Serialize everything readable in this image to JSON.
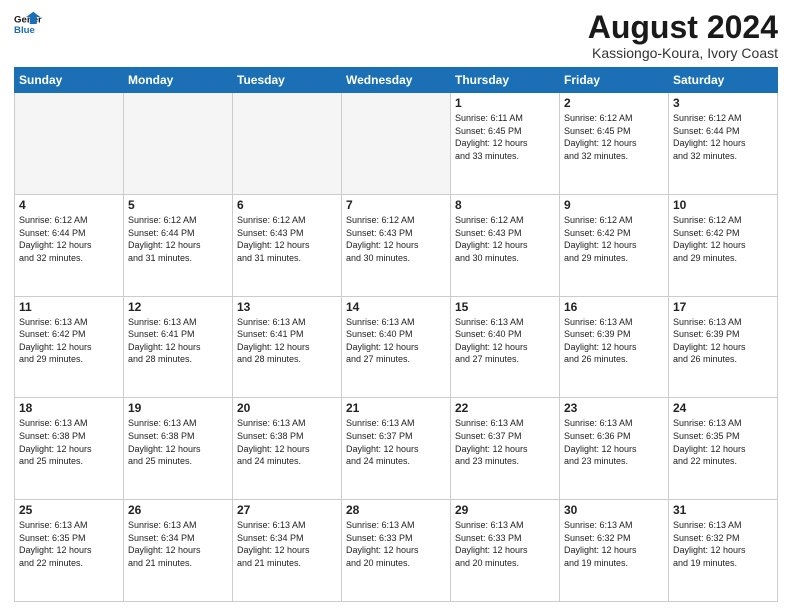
{
  "header": {
    "logo_line1": "General",
    "logo_line2": "Blue",
    "main_title": "August 2024",
    "subtitle": "Kassiongo-Koura, Ivory Coast"
  },
  "calendar": {
    "days_of_week": [
      "Sunday",
      "Monday",
      "Tuesday",
      "Wednesday",
      "Thursday",
      "Friday",
      "Saturday"
    ],
    "weeks": [
      [
        {
          "num": "",
          "info": "",
          "empty": true
        },
        {
          "num": "",
          "info": "",
          "empty": true
        },
        {
          "num": "",
          "info": "",
          "empty": true
        },
        {
          "num": "",
          "info": "",
          "empty": true
        },
        {
          "num": "1",
          "info": "Sunrise: 6:11 AM\nSunset: 6:45 PM\nDaylight: 12 hours\nand 33 minutes."
        },
        {
          "num": "2",
          "info": "Sunrise: 6:12 AM\nSunset: 6:45 PM\nDaylight: 12 hours\nand 32 minutes."
        },
        {
          "num": "3",
          "info": "Sunrise: 6:12 AM\nSunset: 6:44 PM\nDaylight: 12 hours\nand 32 minutes."
        }
      ],
      [
        {
          "num": "4",
          "info": "Sunrise: 6:12 AM\nSunset: 6:44 PM\nDaylight: 12 hours\nand 32 minutes."
        },
        {
          "num": "5",
          "info": "Sunrise: 6:12 AM\nSunset: 6:44 PM\nDaylight: 12 hours\nand 31 minutes."
        },
        {
          "num": "6",
          "info": "Sunrise: 6:12 AM\nSunset: 6:43 PM\nDaylight: 12 hours\nand 31 minutes."
        },
        {
          "num": "7",
          "info": "Sunrise: 6:12 AM\nSunset: 6:43 PM\nDaylight: 12 hours\nand 30 minutes."
        },
        {
          "num": "8",
          "info": "Sunrise: 6:12 AM\nSunset: 6:43 PM\nDaylight: 12 hours\nand 30 minutes."
        },
        {
          "num": "9",
          "info": "Sunrise: 6:12 AM\nSunset: 6:42 PM\nDaylight: 12 hours\nand 29 minutes."
        },
        {
          "num": "10",
          "info": "Sunrise: 6:12 AM\nSunset: 6:42 PM\nDaylight: 12 hours\nand 29 minutes."
        }
      ],
      [
        {
          "num": "11",
          "info": "Sunrise: 6:13 AM\nSunset: 6:42 PM\nDaylight: 12 hours\nand 29 minutes."
        },
        {
          "num": "12",
          "info": "Sunrise: 6:13 AM\nSunset: 6:41 PM\nDaylight: 12 hours\nand 28 minutes."
        },
        {
          "num": "13",
          "info": "Sunrise: 6:13 AM\nSunset: 6:41 PM\nDaylight: 12 hours\nand 28 minutes."
        },
        {
          "num": "14",
          "info": "Sunrise: 6:13 AM\nSunset: 6:40 PM\nDaylight: 12 hours\nand 27 minutes."
        },
        {
          "num": "15",
          "info": "Sunrise: 6:13 AM\nSunset: 6:40 PM\nDaylight: 12 hours\nand 27 minutes."
        },
        {
          "num": "16",
          "info": "Sunrise: 6:13 AM\nSunset: 6:39 PM\nDaylight: 12 hours\nand 26 minutes."
        },
        {
          "num": "17",
          "info": "Sunrise: 6:13 AM\nSunset: 6:39 PM\nDaylight: 12 hours\nand 26 minutes."
        }
      ],
      [
        {
          "num": "18",
          "info": "Sunrise: 6:13 AM\nSunset: 6:38 PM\nDaylight: 12 hours\nand 25 minutes."
        },
        {
          "num": "19",
          "info": "Sunrise: 6:13 AM\nSunset: 6:38 PM\nDaylight: 12 hours\nand 25 minutes."
        },
        {
          "num": "20",
          "info": "Sunrise: 6:13 AM\nSunset: 6:38 PM\nDaylight: 12 hours\nand 24 minutes."
        },
        {
          "num": "21",
          "info": "Sunrise: 6:13 AM\nSunset: 6:37 PM\nDaylight: 12 hours\nand 24 minutes."
        },
        {
          "num": "22",
          "info": "Sunrise: 6:13 AM\nSunset: 6:37 PM\nDaylight: 12 hours\nand 23 minutes."
        },
        {
          "num": "23",
          "info": "Sunrise: 6:13 AM\nSunset: 6:36 PM\nDaylight: 12 hours\nand 23 minutes."
        },
        {
          "num": "24",
          "info": "Sunrise: 6:13 AM\nSunset: 6:35 PM\nDaylight: 12 hours\nand 22 minutes."
        }
      ],
      [
        {
          "num": "25",
          "info": "Sunrise: 6:13 AM\nSunset: 6:35 PM\nDaylight: 12 hours\nand 22 minutes."
        },
        {
          "num": "26",
          "info": "Sunrise: 6:13 AM\nSunset: 6:34 PM\nDaylight: 12 hours\nand 21 minutes."
        },
        {
          "num": "27",
          "info": "Sunrise: 6:13 AM\nSunset: 6:34 PM\nDaylight: 12 hours\nand 21 minutes."
        },
        {
          "num": "28",
          "info": "Sunrise: 6:13 AM\nSunset: 6:33 PM\nDaylight: 12 hours\nand 20 minutes."
        },
        {
          "num": "29",
          "info": "Sunrise: 6:13 AM\nSunset: 6:33 PM\nDaylight: 12 hours\nand 20 minutes."
        },
        {
          "num": "30",
          "info": "Sunrise: 6:13 AM\nSunset: 6:32 PM\nDaylight: 12 hours\nand 19 minutes."
        },
        {
          "num": "31",
          "info": "Sunrise: 6:13 AM\nSunset: 6:32 PM\nDaylight: 12 hours\nand 19 minutes."
        }
      ]
    ]
  }
}
